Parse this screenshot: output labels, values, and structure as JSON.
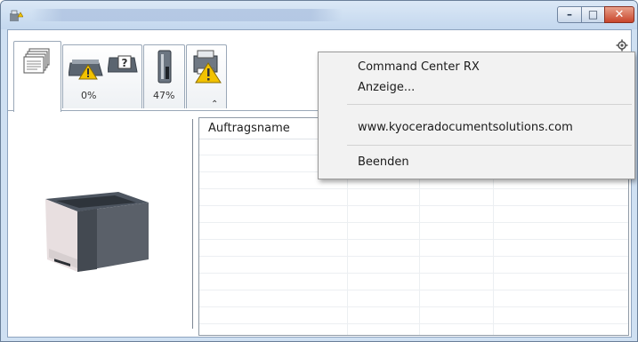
{
  "window": {
    "title": "",
    "controls": {
      "minimize": "–",
      "maximize": "□",
      "close": "✕"
    }
  },
  "tabs": [
    {
      "icon": "document-stack-icon",
      "label": ""
    },
    {
      "icon": "toner-warning-icon",
      "label": "0%"
    },
    {
      "icon": "toner-cartridge-icon",
      "label": "47%"
    },
    {
      "icon": "printer-warning-icon",
      "label": ""
    }
  ],
  "collapse_glyph": "⌃",
  "job_list": {
    "columns": [
      "Auftragsname"
    ],
    "rows": []
  },
  "context_menu": {
    "items": [
      "Command Center RX",
      "Anzeige...",
      "www.kyoceradocumentsolutions.com",
      "Beenden"
    ]
  },
  "colors": {
    "title_bar": "#c3d7ee",
    "close_button": "#c8452b",
    "warning": "#f2c200",
    "menu_bg": "#f2f2f2"
  }
}
